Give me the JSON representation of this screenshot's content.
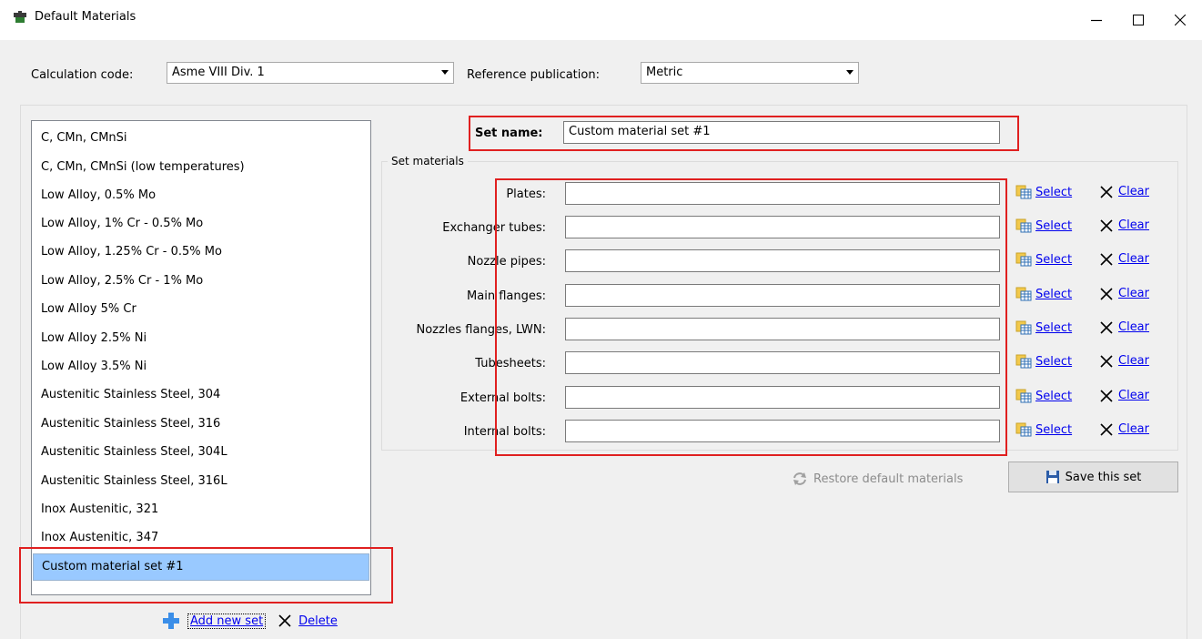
{
  "window": {
    "title": "Default Materials",
    "minimize": "–",
    "maximize": "□",
    "close": "✕"
  },
  "toolbar": {
    "calc_code_label": "Calculation code:",
    "calc_code_value": "Asme VIII Div. 1",
    "ref_pub_label": "Reference publication:",
    "ref_pub_value": "Metric"
  },
  "material_sets": {
    "items": [
      "C, CMn, CMnSi",
      "C, CMn, CMnSi (low temperatures)",
      "Low Alloy, 0.5% Mo",
      "Low Alloy, 1% Cr - 0.5% Mo",
      "Low Alloy, 1.25% Cr - 0.5% Mo",
      "Low Alloy, 2.5% Cr - 1% Mo",
      "Low Alloy 5% Cr",
      "Low Alloy 2.5% Ni",
      "Low Alloy 3.5% Ni",
      "Austenitic Stainless Steel, 304",
      "Austenitic Stainless Steel, 316",
      "Austenitic Stainless Steel, 304L",
      "Austenitic Stainless Steel, 316L",
      "Inox Austenitic, 321",
      "Inox Austenitic, 347",
      "Custom material set #1"
    ],
    "selected": "Custom material set #1",
    "add_label": "Add new set",
    "delete_label": "Delete"
  },
  "set_name": {
    "label": "Set name:",
    "value": "Custom material set #1"
  },
  "set_materials": {
    "title": "Set materials",
    "select_label": "Select",
    "clear_label": "Clear",
    "rows": [
      {
        "label": "Plates:",
        "value": ""
      },
      {
        "label": "Exchanger tubes:",
        "value": ""
      },
      {
        "label": "Nozzle pipes:",
        "value": ""
      },
      {
        "label": "Main flanges:",
        "value": ""
      },
      {
        "label": "Nozzles flanges, LWN:",
        "value": ""
      },
      {
        "label": "Tubesheets:",
        "value": ""
      },
      {
        "label": "External bolts:",
        "value": ""
      },
      {
        "label": "Internal bolts:",
        "value": ""
      }
    ]
  },
  "actions": {
    "restore_label": "Restore default materials",
    "save_label": "Save this set"
  },
  "colors": {
    "highlight": "#e02020",
    "selection": "#99c9ff",
    "link": "#0000ee",
    "disabled_text": "#8c8c8c"
  }
}
